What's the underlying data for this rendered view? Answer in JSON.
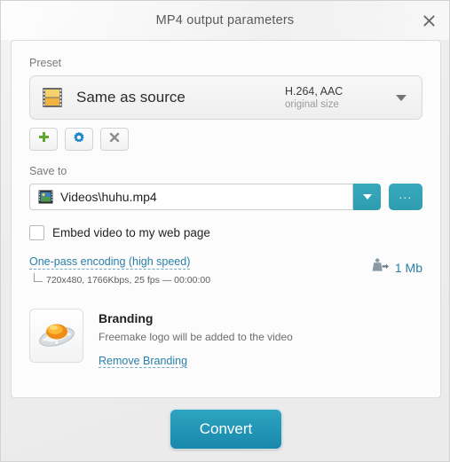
{
  "window": {
    "title": "MP4 output parameters",
    "close_icon": "close-icon"
  },
  "preset": {
    "label": "Preset",
    "icon": "filmstrip-icon",
    "name": "Same as source",
    "codec": "H.264, AAC",
    "size": "original size",
    "dropdown_icon": "chevron-down-icon",
    "actions": [
      {
        "name": "add-preset",
        "icon": "plus-icon",
        "color": "#5fa830"
      },
      {
        "name": "edit-preset",
        "icon": "gear-icon",
        "color": "#1f87c4"
      },
      {
        "name": "delete-preset",
        "icon": "close-x-icon",
        "color": "#8d8d8d"
      }
    ]
  },
  "save_to": {
    "label": "Save to",
    "path": "Videos\\huhu.mp4",
    "path_icon": "video-file-icon",
    "dropdown_icon": "chevron-down-icon",
    "browse_label": "...",
    "browse_icon": "ellipsis-icon"
  },
  "embed": {
    "label": "Embed video to my web page",
    "checked": false
  },
  "encoding": {
    "link": "One-pass encoding (high speed)",
    "details": "720x480, 1766Kbps, 25 fps — 00:00:00",
    "filesize": "1 Mb",
    "filesize_icon": "weight-export-icon"
  },
  "branding": {
    "icon": "freemake-ufo-logo",
    "title": "Branding",
    "description": "Freemake logo will be added to the video",
    "remove_link": "Remove Branding"
  },
  "footer": {
    "convert_label": "Convert"
  },
  "colors": {
    "accent_teal": "#2f9cb0",
    "link_blue": "#2a7fa8",
    "convert_blue": "#1888ab"
  }
}
